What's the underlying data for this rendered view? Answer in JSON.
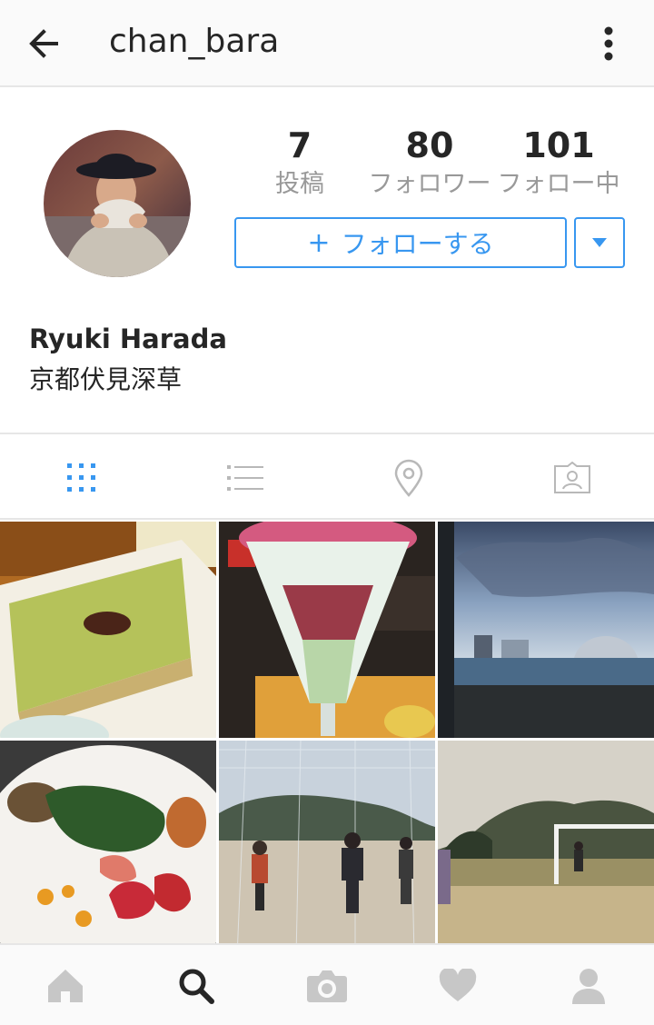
{
  "appbar": {
    "username": "chan_bara",
    "back_icon": "arrow-left-icon",
    "more_icon": "more-vertical-icon"
  },
  "profile": {
    "stats": [
      {
        "value": "7",
        "label": "投稿"
      },
      {
        "value": "80",
        "label": "フォロワー"
      },
      {
        "value": "101",
        "label": "フォロー中"
      }
    ],
    "follow_button": {
      "plus": "+",
      "label": "フォローする"
    },
    "full_name": "Ryuki Harada",
    "bio": "京都伏見深草"
  },
  "tabs": [
    {
      "icon": "grid-icon",
      "active": true
    },
    {
      "icon": "list-icon",
      "active": false
    },
    {
      "icon": "location-pin-icon",
      "active": false
    },
    {
      "icon": "tagged-photos-icon",
      "active": false
    }
  ],
  "photos": [
    {
      "subject": "green-cake"
    },
    {
      "subject": "parfait"
    },
    {
      "subject": "harbor-sky"
    },
    {
      "subject": "salad-plate"
    },
    {
      "subject": "soccer-players"
    },
    {
      "subject": "soccer-field"
    }
  ],
  "bottom_nav": [
    {
      "icon": "home-icon",
      "active": false
    },
    {
      "icon": "search-icon",
      "active": true
    },
    {
      "icon": "camera-icon",
      "active": false
    },
    {
      "icon": "heart-icon",
      "active": false
    },
    {
      "icon": "profile-icon",
      "active": false
    }
  ],
  "colors": {
    "accent": "#3897f0",
    "text": "#262626",
    "muted": "#999999",
    "inactive_icon": "#c7c7c7"
  }
}
